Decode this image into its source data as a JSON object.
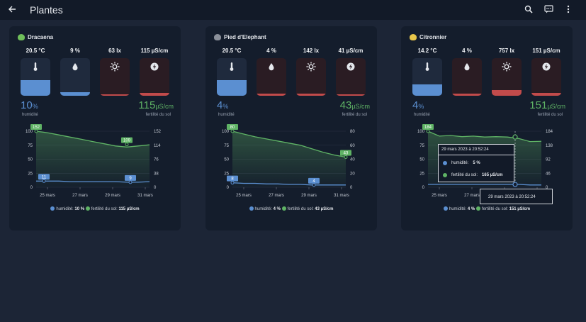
{
  "appbar": {
    "title": "Plantes",
    "icons": [
      "back-arrow-icon",
      "search-icon",
      "chat-icon",
      "more-vert-icon"
    ]
  },
  "colors": {
    "humidity": "#5b8fd1",
    "fertility": "#5fb365",
    "temp_fill": "#5b8fd1",
    "bad_fill": "#c24b4b",
    "box_bg": "#2a1c23",
    "temp_box_bg": "#1f2a3d"
  },
  "plants": [
    {
      "name": "Dracaena",
      "sensors": [
        {
          "value": "20.5 °C",
          "icon": "thermometer-icon"
        },
        {
          "value": "9 %",
          "icon": "water-drop-icon"
        },
        {
          "value": "63 lx",
          "icon": "sun-icon"
        },
        {
          "value": "115 µS/cm",
          "icon": "flash-icon"
        }
      ],
      "humidity_value": "10",
      "humidity_unit": "%",
      "humidity_label": "humidité",
      "fertility_value": "115",
      "fertility_unit": "µS/cm",
      "fertility_label": "fertilité du sol",
      "chart_data": {
        "type": "line",
        "x_ticks": [
          "25 mars",
          "27 mars",
          "29 mars",
          "31 mars"
        ],
        "y_left_ticks": [
          "100",
          "75",
          "50",
          "25",
          "0"
        ],
        "y_right_ticks": [
          "152",
          "114",
          "76",
          "38",
          "0"
        ],
        "ylim_left": [
          0,
          100
        ],
        "ylim_right": [
          0,
          152
        ],
        "series": [
          {
            "name": "humidité",
            "values": [
              11,
              11,
              11,
              10,
              10,
              10,
              10,
              10,
              9,
              9,
              10
            ]
          },
          {
            "name": "fertilité du sol",
            "values": [
              152,
              148,
              142,
              136,
              130,
              124,
              118,
              112,
              109,
              112,
              115
            ]
          }
        ],
        "labels": {
          "fert_max": "152",
          "fert_mark": "109",
          "hum_start": "11",
          "hum_end": "9"
        }
      },
      "legend": {
        "humidity": "humidité:",
        "humidity_val": "10 %",
        "fertility": "fertilité du sol:",
        "fertility_val": "115 µS/cm"
      }
    },
    {
      "name": "Pied d'Elephant",
      "sensors": [
        {
          "value": "20.5 °C",
          "icon": "thermometer-icon"
        },
        {
          "value": "4 %",
          "icon": "water-drop-icon"
        },
        {
          "value": "142 lx",
          "icon": "sun-icon"
        },
        {
          "value": "41 µS/cm",
          "icon": "flash-icon"
        }
      ],
      "humidity_value": "4",
      "humidity_unit": "%",
      "humidity_label": "humidité",
      "fertility_value": "43",
      "fertility_unit": "µS/cm",
      "fertility_label": "fertilité du sol",
      "chart_data": {
        "type": "line",
        "x_ticks": [
          "25 mars",
          "27 mars",
          "29 mars",
          "31 mars"
        ],
        "y_left_ticks": [
          "100",
          "75",
          "50",
          "25",
          "0"
        ],
        "y_right_ticks": [
          "80",
          "60",
          "40",
          "20",
          "0"
        ],
        "ylim_left": [
          0,
          100
        ],
        "ylim_right": [
          0,
          80
        ],
        "series": [
          {
            "name": "humidité",
            "values": [
              8,
              7,
              7,
              6,
              6,
              5,
              5,
              4,
              4,
              4,
              4
            ]
          },
          {
            "name": "fertilité du sol",
            "values": [
              80,
              76,
              72,
              69,
              66,
              63,
              60,
              55,
              50,
              46,
              43
            ]
          }
        ],
        "labels": {
          "fert_max": "80",
          "fert_mark": "43",
          "hum_start": "8",
          "hum_end": "4"
        }
      },
      "legend": {
        "humidity": "humidité:",
        "humidity_val": "4 %",
        "fertility": "fertilité du sol:",
        "fertility_val": "43 µS/cm"
      }
    },
    {
      "name": "Citronnier",
      "sensors": [
        {
          "value": "14.2 °C",
          "icon": "thermometer-icon"
        },
        {
          "value": "4 %",
          "icon": "water-drop-icon"
        },
        {
          "value": "757 lx",
          "icon": "sun-icon"
        },
        {
          "value": "151 µS/cm",
          "icon": "flash-icon"
        }
      ],
      "humidity_value": "4",
      "humidity_unit": "%",
      "humidity_label": "humidité",
      "fertility_value": "151",
      "fertility_unit": "µS/cm",
      "fertility_label": "fertilité du sol",
      "chart_data": {
        "type": "line",
        "x_ticks": [
          "25 mars",
          "27 mars",
          "29 mars",
          "31 mars"
        ],
        "y_left_ticks": [
          "100",
          "75",
          "50",
          "25",
          "0"
        ],
        "y_right_ticks": [
          "184",
          "138",
          "92",
          "46",
          "0"
        ],
        "ylim_left": [
          0,
          100
        ],
        "ylim_right": [
          0,
          184
        ],
        "series": [
          {
            "name": "humidité",
            "values": [
              5,
              5,
              5,
              5,
              5,
              5,
              5,
              5,
              5,
              4,
              4
            ]
          },
          {
            "name": "fertilité du sol",
            "values": [
              184,
              168,
              170,
              166,
              168,
              165,
              166,
              165,
              160,
              150,
              151
            ]
          }
        ],
        "labels": {
          "fert_max": "184"
        }
      },
      "legend": {
        "humidity": "humidité:",
        "humidity_val": "4 %",
        "fertility": "fertilité du sol:",
        "fertility_val": "151 µS/cm"
      },
      "tooltip": {
        "date": "29 mars 2023 à 20:52:24",
        "humidity_label": "humidité:",
        "humidity_val": "5 %",
        "fertility_label": "fertilité du sol:",
        "fertility_val": "165 µS/cm",
        "x_label": "29 mars 2023 à 20:52:24"
      }
    }
  ]
}
